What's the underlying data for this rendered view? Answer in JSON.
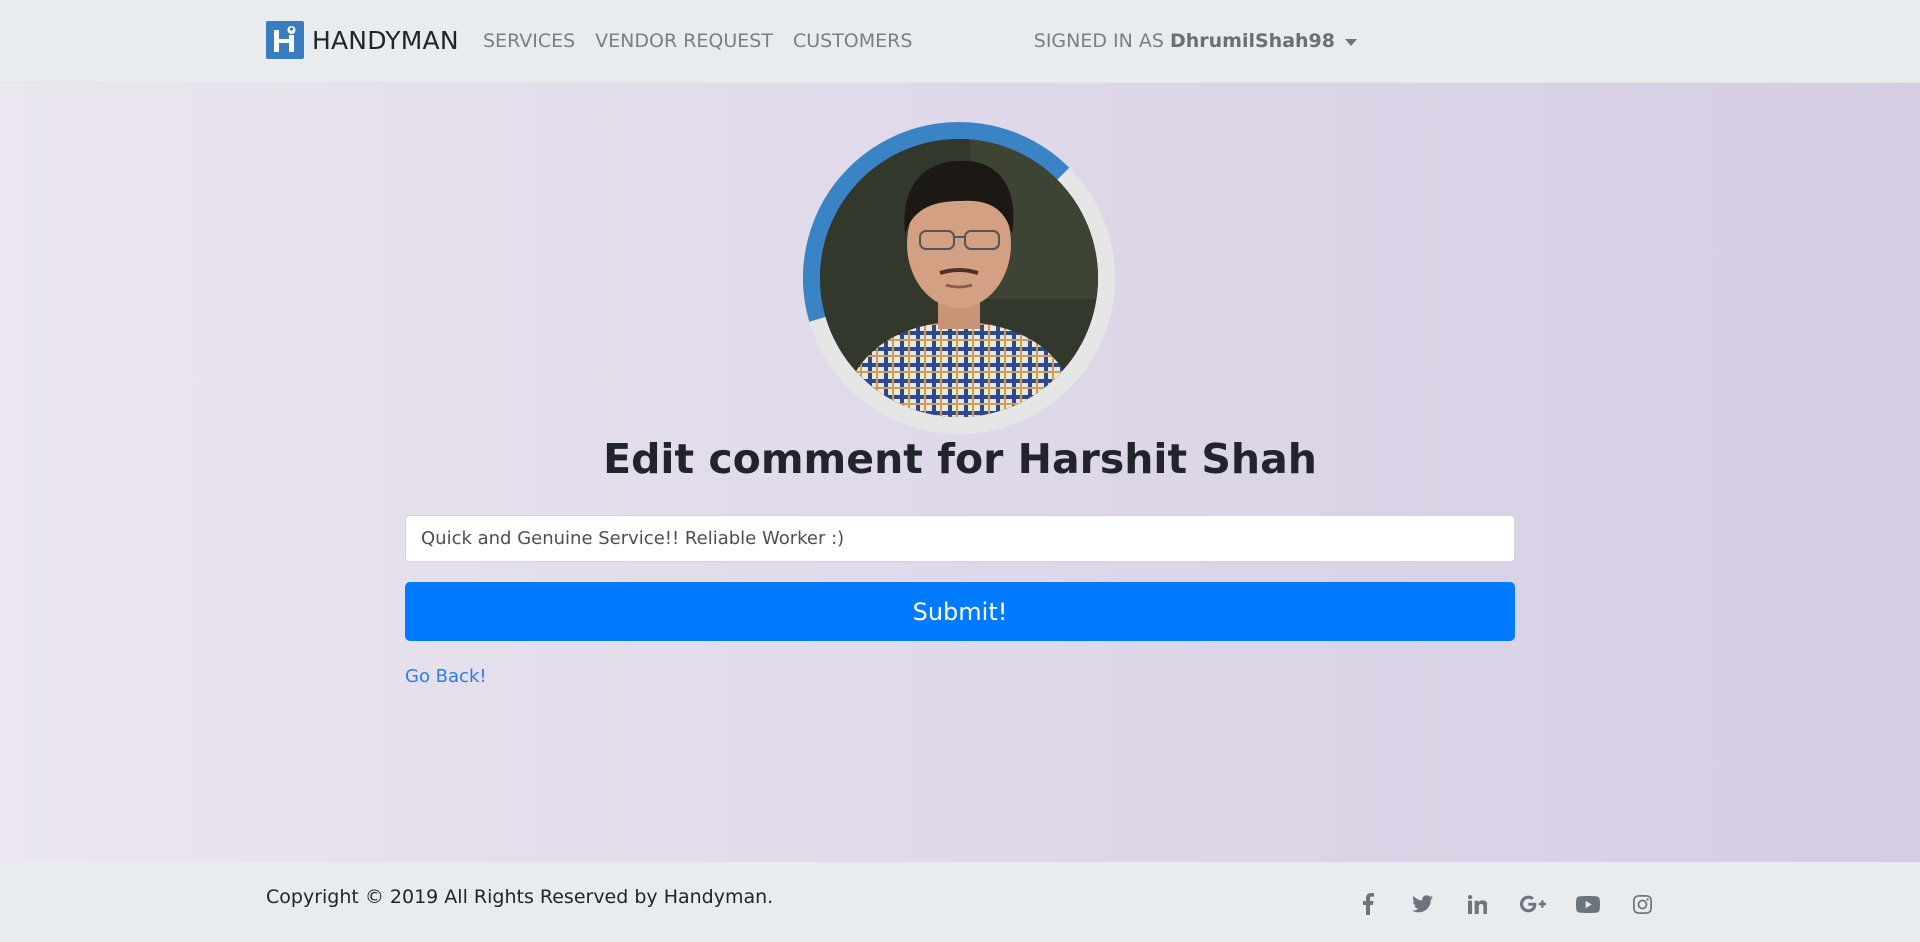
{
  "navbar": {
    "brand": "HANDYMAN",
    "links": [
      "SERVICES",
      "VENDOR REQUEST",
      "CUSTOMERS"
    ],
    "signed_in_prefix": "SIGNED IN AS",
    "username": "DhrumilShah98"
  },
  "main": {
    "heading_prefix": "Edit comment for",
    "heading_name": "Harshit Shah",
    "comment_value": "Quick and Genuine Service!! Reliable Worker :)",
    "submit_label": "Submit!",
    "back_label": "Go Back!",
    "rating_fraction": 0.42
  },
  "footer": {
    "copyright": "Copyright © 2019 All Rights Reserved by Handyman.",
    "social_icons": [
      "facebook-icon",
      "twitter-icon",
      "linkedin-icon",
      "google-plus-icon",
      "youtube-icon",
      "instagram-icon"
    ]
  },
  "colors": {
    "accent": "#007bff",
    "ring_progress": "#3a84c6",
    "ring_track": "#e6e6e6",
    "brand_logo": "#3a7cc0"
  }
}
